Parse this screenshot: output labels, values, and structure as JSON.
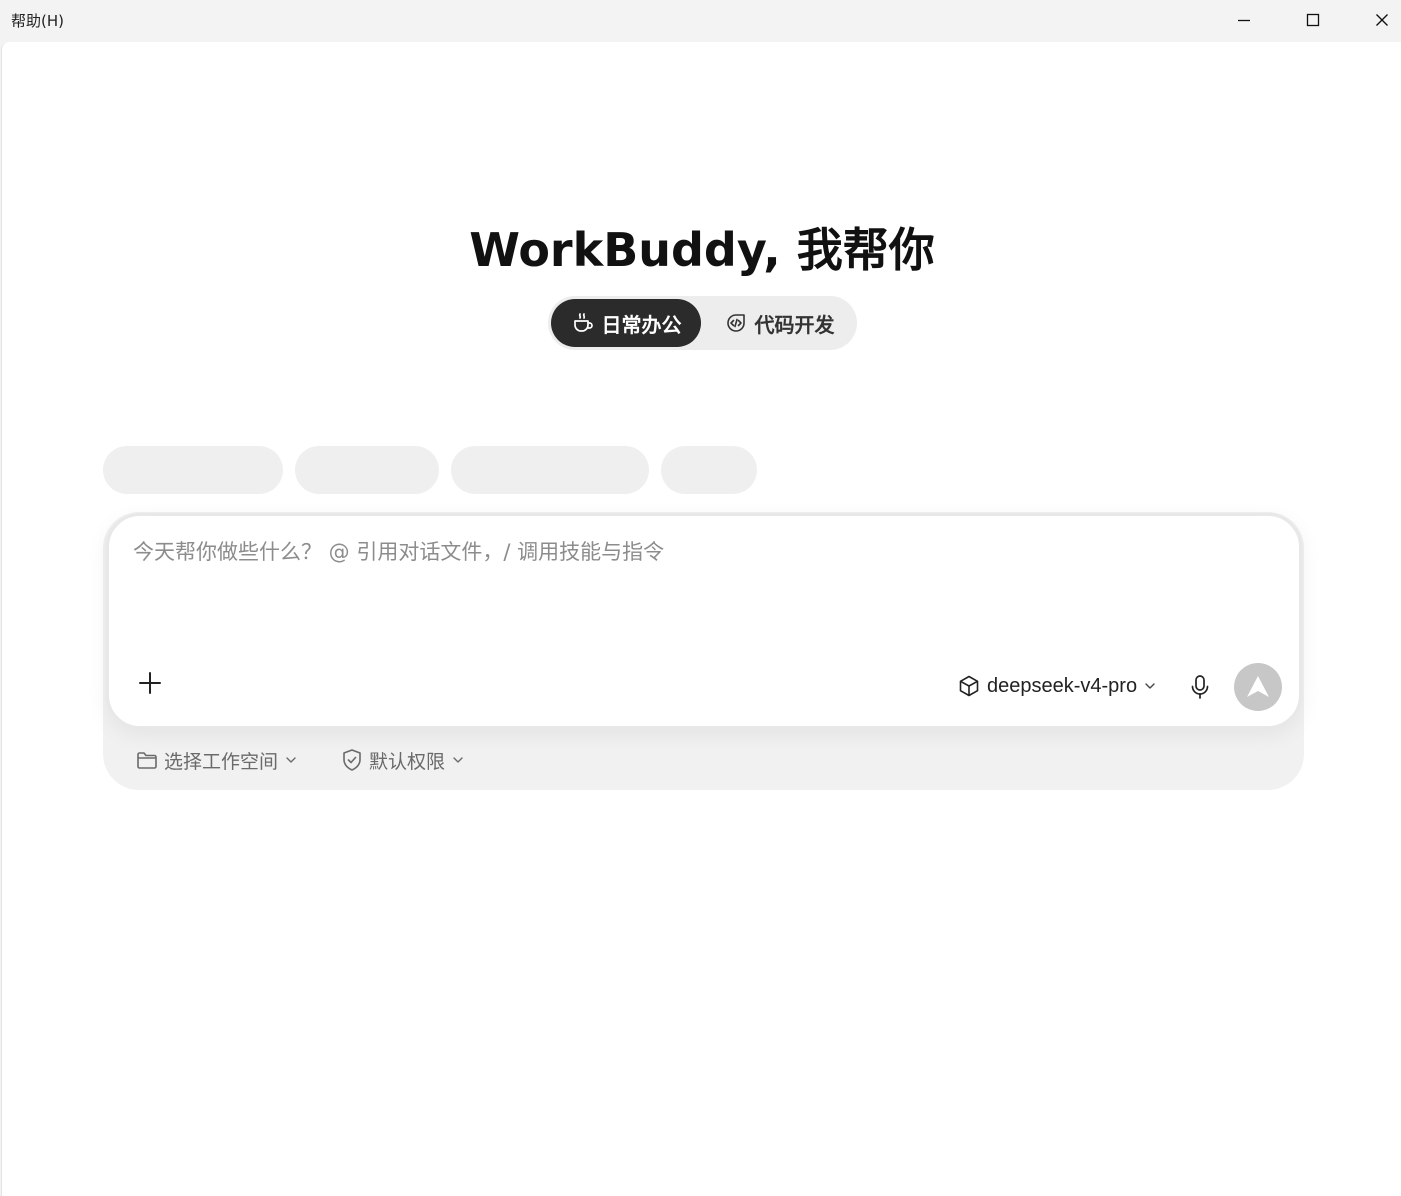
{
  "titlebar": {
    "menu_help": "帮助(H)",
    "controls": [
      "minimize-icon",
      "maximize-icon",
      "close-icon"
    ]
  },
  "hero": {
    "title": "WorkBuddy, 我帮你"
  },
  "modes": [
    {
      "label": "日常办公",
      "icon": "coffee-cup-icon",
      "active": true
    },
    {
      "label": "代码开发",
      "icon": "code-icon",
      "active": false
    }
  ],
  "composer": {
    "placeholder": "今天帮你做些什么？ @ 引用对话文件，/ 调用技能与指令",
    "model": "deepseek-v4-pro",
    "icons": [
      "plus-icon",
      "cube-icon",
      "chevron-down-icon",
      "microphone-icon",
      "send-arrow-icon"
    ]
  },
  "footer": {
    "workspace_label": "选择工作空间",
    "permission_label": "默认权限"
  },
  "colors": {
    "active_tab_bg": "#2b2b2b",
    "send_disabled": "#c7c7c7",
    "chip_placeholder": "#efefef"
  }
}
